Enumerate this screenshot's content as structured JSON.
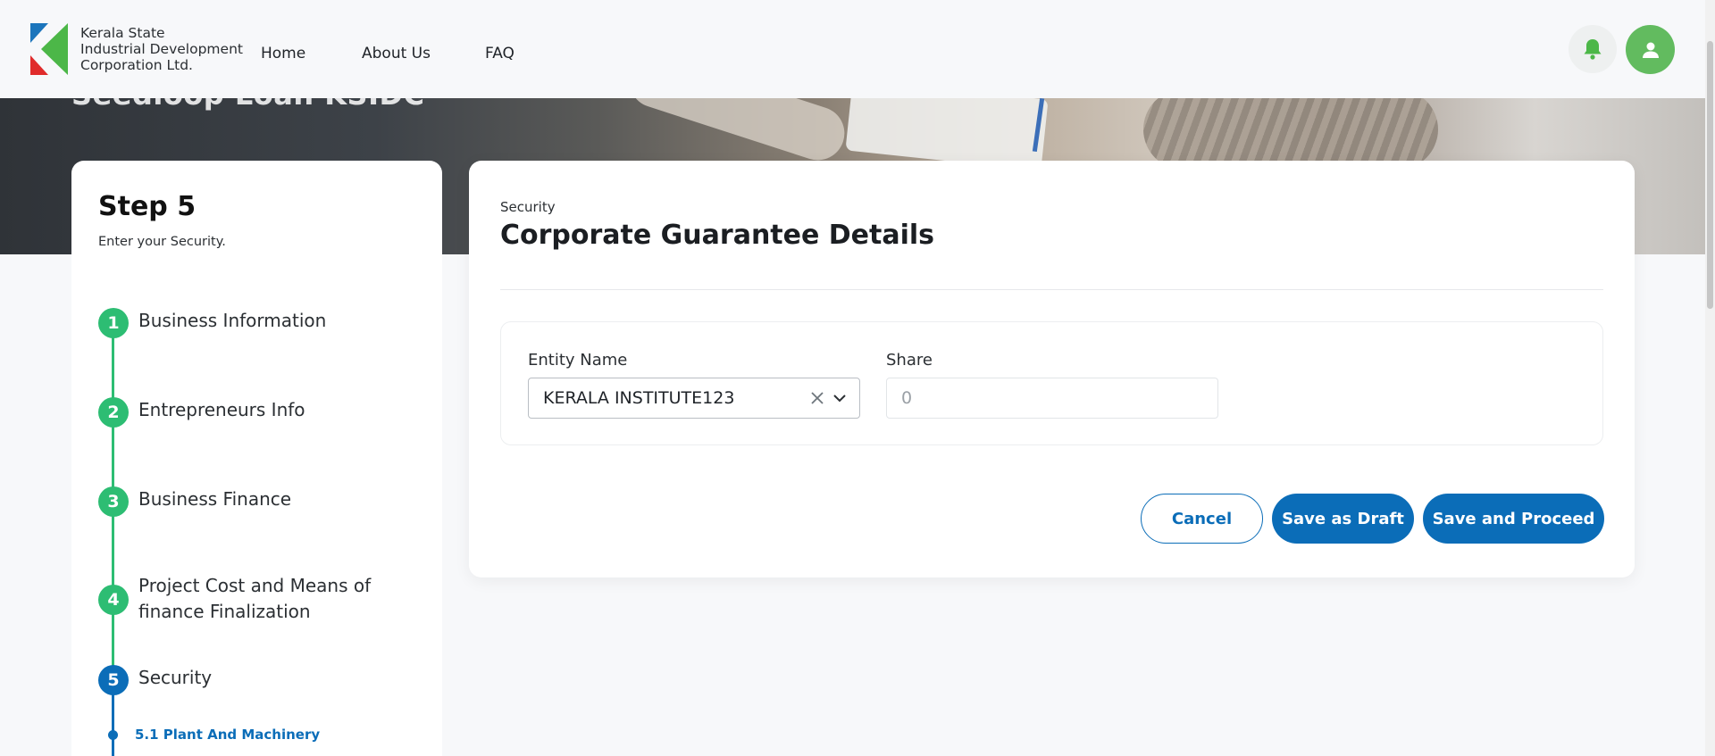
{
  "header": {
    "logo_lines": [
      "Kerala State",
      "Industrial Development",
      "Corporation Ltd."
    ],
    "nav": [
      "Home",
      "About Us",
      "FAQ"
    ],
    "icons": {
      "notifications": "bell-icon",
      "profile": "user-icon"
    }
  },
  "hero": {
    "title": "Seedloop Loan KSIDC"
  },
  "stepper": {
    "heading": "Step 5",
    "subtitle": "Enter your Security.",
    "steps": [
      {
        "number": "1",
        "label": "Business Information",
        "status": "completed"
      },
      {
        "number": "2",
        "label": "Entrepreneurs Info",
        "status": "completed"
      },
      {
        "number": "3",
        "label": "Business Finance",
        "status": "completed"
      },
      {
        "number": "4",
        "label": "Project Cost and Means of finance Finalization",
        "status": "completed"
      },
      {
        "number": "5",
        "label": "Security",
        "status": "active"
      }
    ],
    "substep": "5.1 Plant And Machinery"
  },
  "form": {
    "eyebrow": "Security",
    "title": "Corporate Guarantee Details",
    "entity_name": {
      "label": "Entity Name",
      "value": "KERALA INSTITUTE123"
    },
    "share": {
      "label": "Share",
      "placeholder": "0",
      "value": ""
    }
  },
  "actions": {
    "cancel": "Cancel",
    "save_draft": "Save as Draft",
    "save_proceed": "Save and Proceed"
  },
  "colors": {
    "primary": "#0b6db8",
    "completed_step": "#2dbd73",
    "avatar": "#62bb5f"
  }
}
